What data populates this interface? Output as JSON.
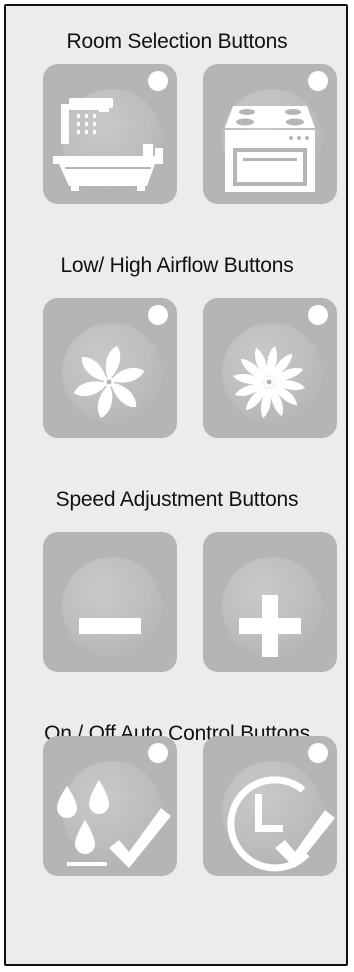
{
  "sections": [
    {
      "title": "Room Selection Buttons",
      "buttons": [
        {
          "icon": "bathroom-icon"
        },
        {
          "icon": "kitchen-stove-icon"
        }
      ]
    },
    {
      "title": "Low/ High Airflow Buttons",
      "buttons": [
        {
          "icon": "fan-low-icon"
        },
        {
          "icon": "fan-high-icon"
        }
      ]
    },
    {
      "title": "Speed Adjustment Buttons",
      "buttons": [
        {
          "icon": "minus-icon"
        },
        {
          "icon": "plus-icon"
        }
      ]
    },
    {
      "title": "On / Off Auto Control Buttons",
      "buttons": [
        {
          "icon": "humidity-auto-icon"
        },
        {
          "icon": "timer-auto-icon"
        }
      ]
    }
  ],
  "colors": {
    "panel_background": "#ececec",
    "button_background": "#b5b5b5",
    "icon_fill": "#ffffff",
    "border": "#111111"
  }
}
